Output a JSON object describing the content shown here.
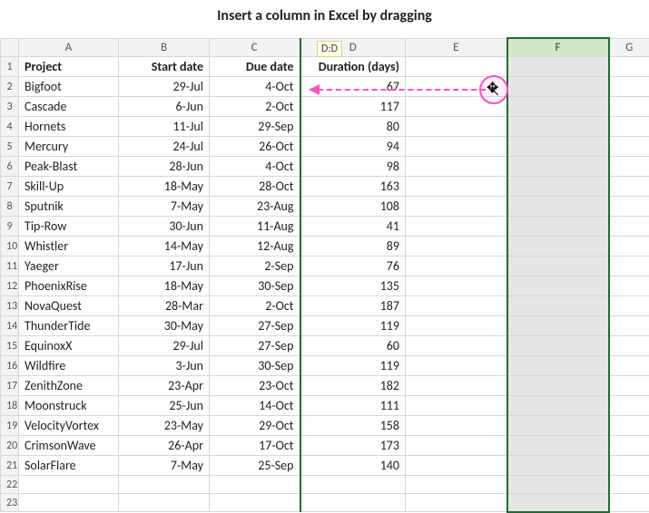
{
  "title": "Insert a column in Excel by dragging",
  "drag_tip": "D:D",
  "columns": [
    "A",
    "B",
    "C",
    "D",
    "E",
    "F",
    "G"
  ],
  "rownums": [
    "1",
    "2",
    "3",
    "4",
    "5",
    "6",
    "7",
    "8",
    "9",
    "10",
    "11",
    "12",
    "13",
    "14",
    "15",
    "16",
    "17",
    "18",
    "19",
    "20",
    "21",
    "22",
    "23"
  ],
  "header": {
    "project": "Project",
    "start": "Start date",
    "due": "Due date",
    "dur": "Duration (days)"
  },
  "rows": [
    {
      "project": "Bigfoot",
      "start": "29-Jul",
      "due": "4-Oct",
      "dur": "67"
    },
    {
      "project": "Cascade",
      "start": "6-Jun",
      "due": "2-Oct",
      "dur": "117"
    },
    {
      "project": "Hornets",
      "start": "11-Jul",
      "due": "29-Sep",
      "dur": "80"
    },
    {
      "project": "Mercury",
      "start": "24-Jul",
      "due": "26-Oct",
      "dur": "94"
    },
    {
      "project": "Peak-Blast",
      "start": "28-Jun",
      "due": "4-Oct",
      "dur": "98"
    },
    {
      "project": "Skill-Up",
      "start": "18-May",
      "due": "28-Oct",
      "dur": "163"
    },
    {
      "project": "Sputnik",
      "start": "7-May",
      "due": "23-Aug",
      "dur": "108"
    },
    {
      "project": "Tip-Row",
      "start": "30-Jun",
      "due": "11-Aug",
      "dur": "41"
    },
    {
      "project": "Whistler",
      "start": "14-May",
      "due": "12-Aug",
      "dur": "89"
    },
    {
      "project": "Yaeger",
      "start": "17-Jun",
      "due": "2-Sep",
      "dur": "76"
    },
    {
      "project": "PhoenixRise",
      "start": "18-May",
      "due": "30-Sep",
      "dur": "135"
    },
    {
      "project": "NovaQuest",
      "start": "28-Mar",
      "due": "2-Oct",
      "dur": "187"
    },
    {
      "project": "ThunderTide",
      "start": "30-May",
      "due": "27-Sep",
      "dur": "119"
    },
    {
      "project": "EquinoxX",
      "start": "29-Jul",
      "due": "27-Sep",
      "dur": "60"
    },
    {
      "project": "Wildfire",
      "start": "3-Jun",
      "due": "30-Sep",
      "dur": "119"
    },
    {
      "project": "ZenithZone",
      "start": "23-Apr",
      "due": "23-Oct",
      "dur": "182"
    },
    {
      "project": "Moonstruck",
      "start": "25-Jun",
      "due": "14-Oct",
      "dur": "111"
    },
    {
      "project": "VelocityVortex",
      "start": "23-May",
      "due": "29-Oct",
      "dur": "158"
    },
    {
      "project": "CrimsonWave",
      "start": "26-Apr",
      "due": "17-Oct",
      "dur": "173"
    },
    {
      "project": "SolarFlare",
      "start": "7-May",
      "due": "25-Sep",
      "dur": "140"
    }
  ]
}
